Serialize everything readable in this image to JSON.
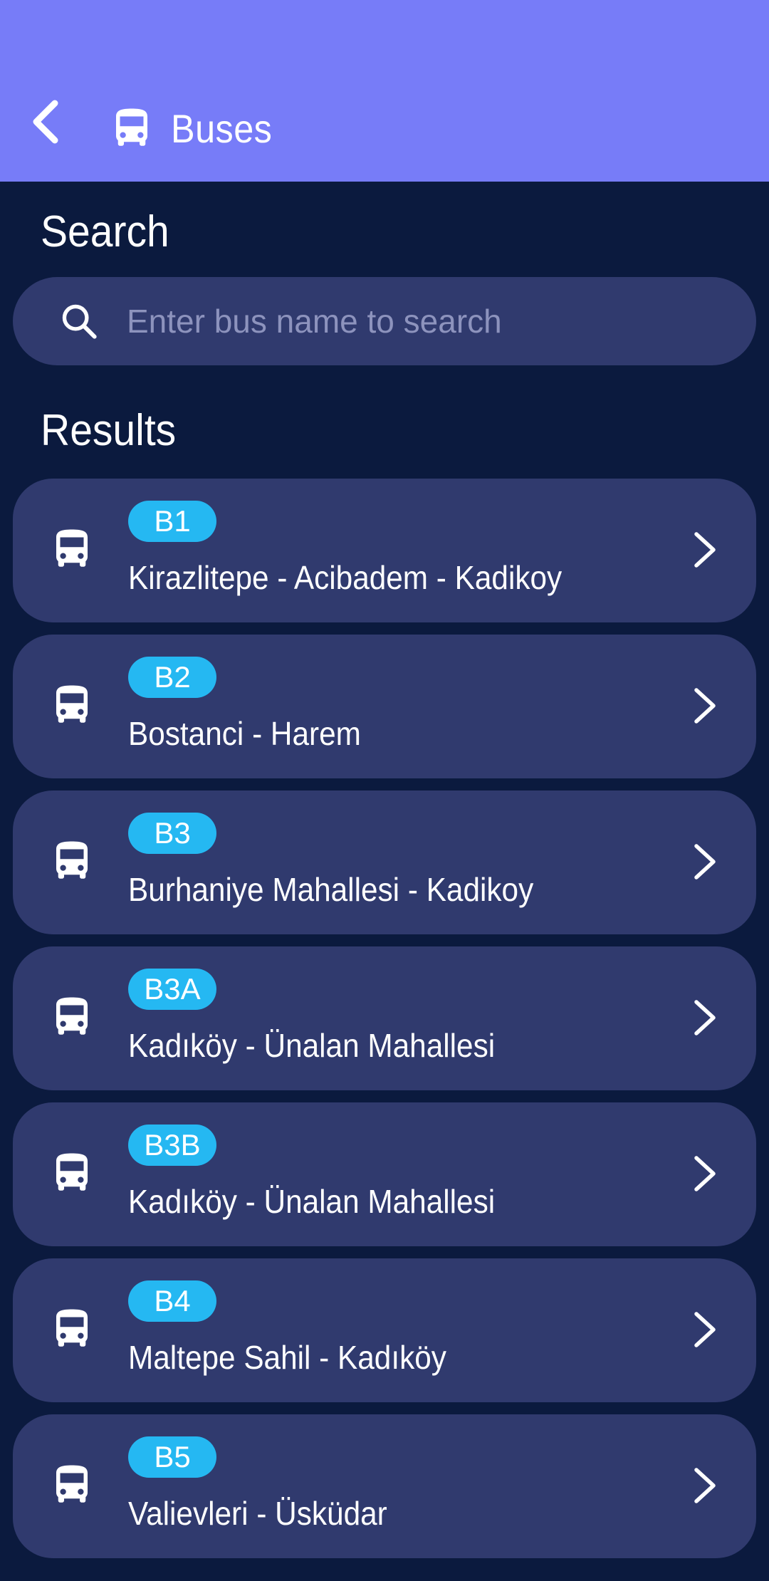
{
  "header": {
    "title": "Buses",
    "back_icon": "chevron-left-icon",
    "title_icon": "bus-icon",
    "background": "#777cf8"
  },
  "search": {
    "title": "Search",
    "placeholder": "Enter bus name to search",
    "value": "",
    "icon": "search-icon"
  },
  "results": {
    "title": "Results",
    "items": [
      {
        "code": "B1",
        "route": "Kirazlitepe - Acibadem - Kadikoy"
      },
      {
        "code": "B2",
        "route": "Bostanci - Harem"
      },
      {
        "code": "B3",
        "route": "Burhaniye Mahallesi - Kadikoy"
      },
      {
        "code": "B3A",
        "route": "Kadıköy - Ünalan Mahallesi"
      },
      {
        "code": "B3B",
        "route": "Kadıköy - Ünalan Mahallesi"
      },
      {
        "code": "B4",
        "route": "Maltepe Sahil - Kadıköy"
      },
      {
        "code": "B5",
        "route": "Valievleri - Üsküdar"
      }
    ]
  },
  "colors": {
    "background": "#0b1a3e",
    "card": "#303a6e",
    "badge": "#25b8f2",
    "accent": "#777cf8"
  }
}
